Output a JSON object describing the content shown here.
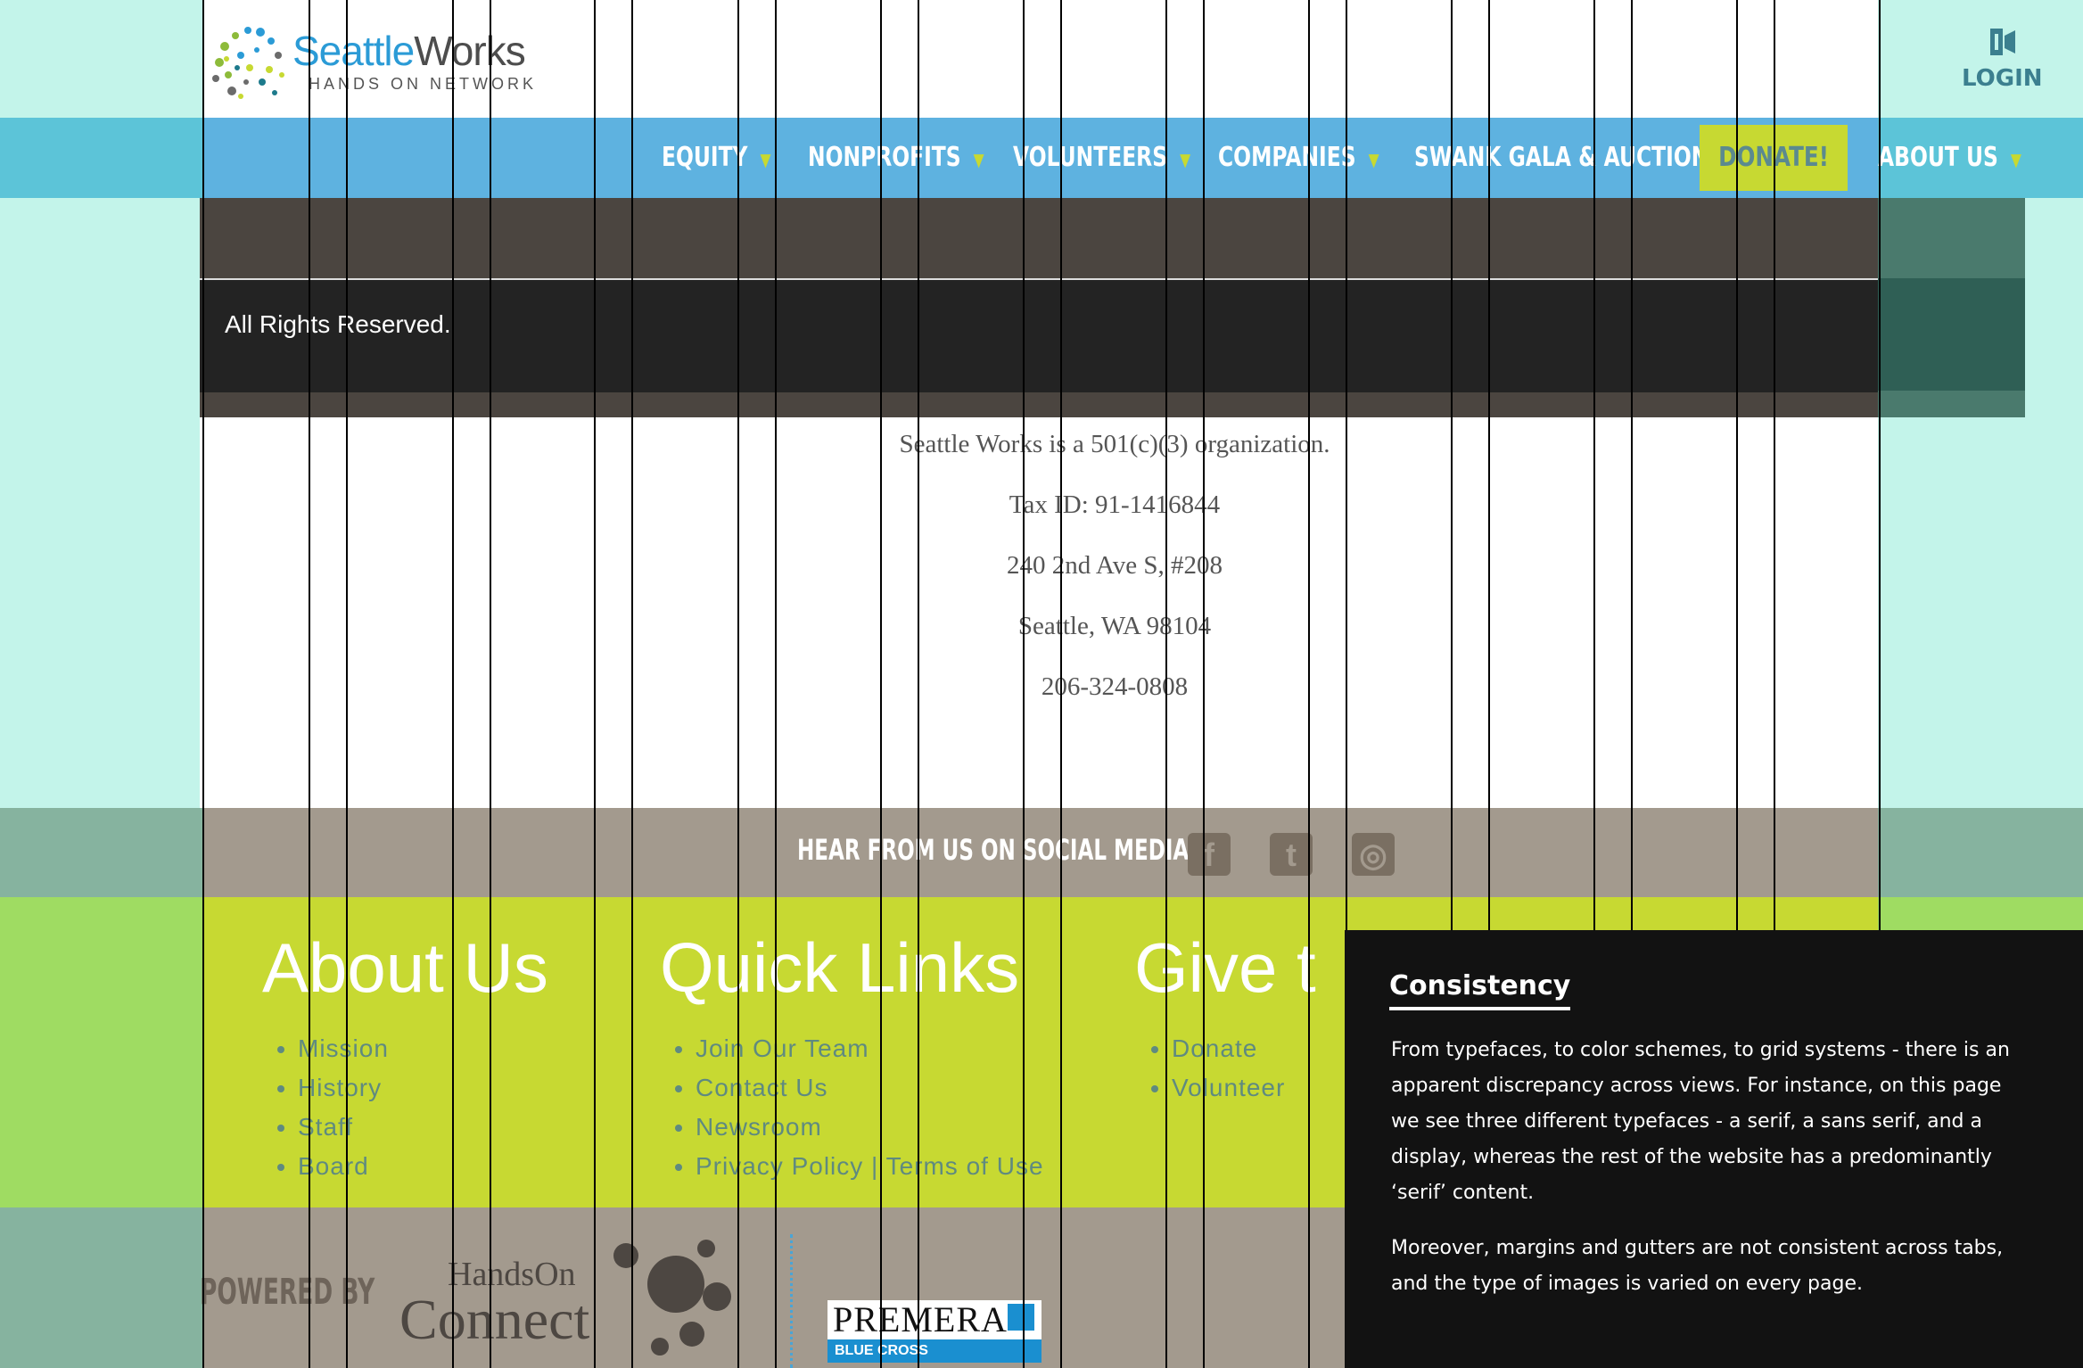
{
  "colors": {
    "side_tint_top": "#c3f4ea",
    "nav_blue": "#5eb2e0",
    "accent_lime": "#c7d932",
    "dark_band": "#4b4540",
    "taupe": "#a39a8e",
    "panel_bg": "#121212"
  },
  "header": {
    "logo_word_a": "Seattle",
    "logo_word_b": "Works",
    "logo_tagline": "HANDS ON NETWORK",
    "login_label": "LOGIN"
  },
  "nav": {
    "items": [
      {
        "label": "EQUITY"
      },
      {
        "label": "NONPROFITS"
      },
      {
        "label": "VOLUNTEERS"
      },
      {
        "label": "COMPANIES"
      },
      {
        "label": "SWANK GALA & AUCTION"
      },
      {
        "label": "ABOUT US"
      }
    ],
    "donate_label": "DONATE!"
  },
  "footer_top": {
    "rights": "All Rights Reserved."
  },
  "org_info": [
    "Seattle Works is a 501(c)(3) organization.",
    "Tax ID: 91-1416844",
    "240 2nd Ave S, #208",
    "Seattle, WA 98104",
    "206-324-0808"
  ],
  "social": {
    "title": "HEAR FROM US ON SOCIAL MEDIA!",
    "icons": [
      "facebook-icon",
      "twitter-icon",
      "instagram-icon"
    ]
  },
  "footer_columns": [
    {
      "title": "About Us",
      "links": [
        "Mission",
        "History",
        "Staff",
        "Board"
      ]
    },
    {
      "title": "Quick Links",
      "links": [
        "Join Our Team",
        "Contact Us",
        "Newsroom",
        "Privacy Policy | Terms of Use"
      ]
    },
    {
      "title": "Give t",
      "links": [
        "Donate",
        "Volunteer"
      ]
    }
  ],
  "powered": {
    "label": "POWERED BY",
    "handson_line1": "HandsOn",
    "handson_line2": "Connect",
    "sponsor_name": "PREMERA",
    "sponsor_sub": "BLUE CROSS"
  },
  "annotation": {
    "title": "Consistency",
    "paragraph1": "From typefaces, to color schemes, to grid systems - there is an apparent discrepancy across views. For instance, on this page we see three different typefaces - a serif, a sans serif, and a display, whereas the rest of the website has a predominantly ‘serif’ content.",
    "paragraph2": "Moreover, margins and gutters are not consistent across tabs, and the type of images is varied on every page."
  }
}
